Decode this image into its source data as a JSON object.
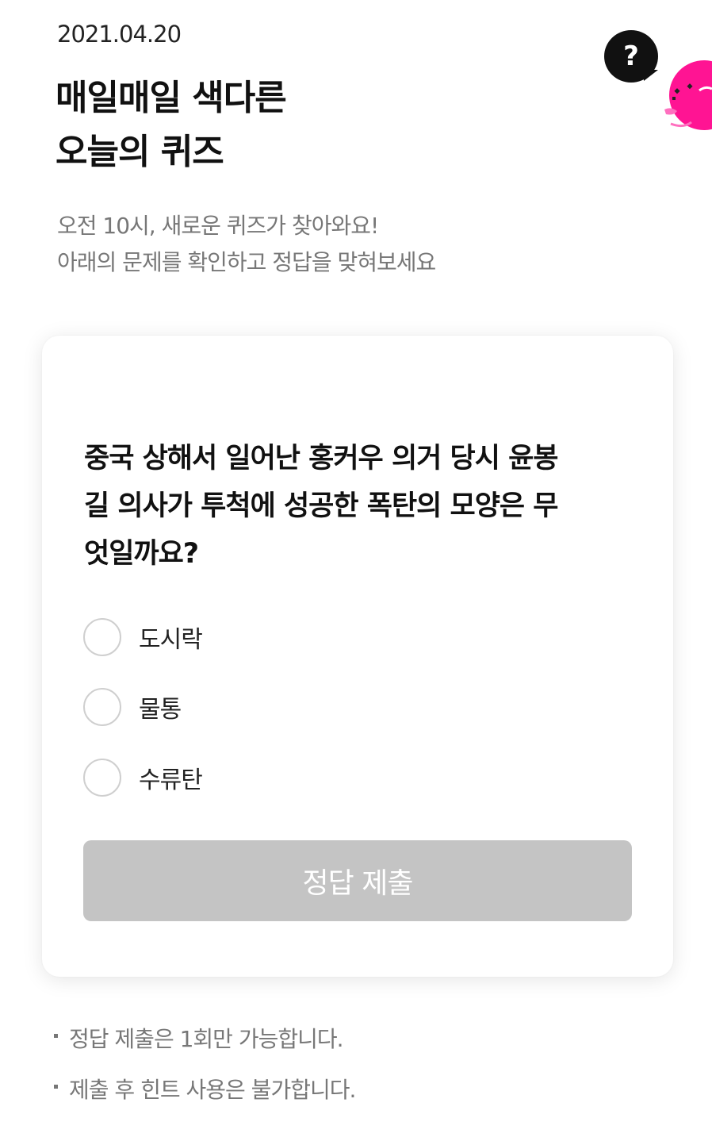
{
  "header": {
    "date": "2021.04.20",
    "title_line1": "매일매일 색다른",
    "title_line2": "오늘의 퀴즈",
    "subtitle_line1": "오전 10시, 새로운 퀴즈가 찾아와요!",
    "subtitle_line2": "아래의 문제를 확인하고 정답을 맞혀보세요",
    "help_icon_glyph": "?"
  },
  "quiz": {
    "question_line1": "중국 상해서 일어난 홍커우 의거 당시 윤봉",
    "question_line2": "길 의사가 투척에 성공한 폭탄의 모양은 무",
    "question_line3": "엇일까요?",
    "options": [
      {
        "label": "도시락"
      },
      {
        "label": "물통"
      },
      {
        "label": "수류탄"
      }
    ],
    "submit_label": "정답 제출"
  },
  "notes": [
    "정답 제출은 1회만 가능합니다.",
    "제출 후 힌트 사용은 불가합니다."
  ],
  "colors": {
    "submit_disabled_bg": "#c4c4c4",
    "mascot_pink": "#ff1493",
    "help_bubble": "#111111"
  }
}
